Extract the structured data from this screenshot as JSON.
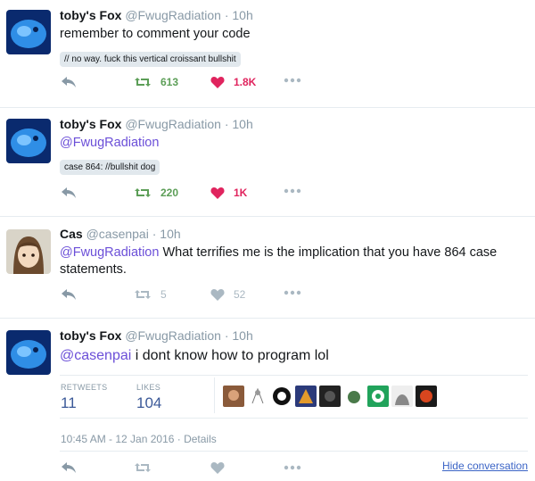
{
  "tweets": [
    {
      "name": "toby's Fox",
      "handle": "@FwugRadiation",
      "time": "· 10h",
      "text": "remember to comment your code",
      "code": "// no way. fuck this vertical croissant bullshit",
      "retweets": "613",
      "likes": "1.8K"
    },
    {
      "name": "toby's Fox",
      "handle": "@FwugRadiation",
      "time": "· 10h",
      "mention": "@FwugRadiation",
      "code": "case 864: //bullshit dog",
      "retweets": "220",
      "likes": "1K"
    },
    {
      "name": "Cas",
      "handle": "@casenpai",
      "time": "· 10h",
      "mention": "@FwugRadiation",
      "text": " What terrifies me is the implication that you have 864 case statements.",
      "retweets": "5",
      "likes": "52"
    },
    {
      "name": "toby's Fox",
      "handle": "@FwugRadiation",
      "time": "· 10h",
      "mention": "@casenpai",
      "text": " i dont know how to program lol",
      "retweets_label": "RETWEETS",
      "retweets": "11",
      "likes_label": "LIKES",
      "likes": "104",
      "timestamp": "10:45 AM - 12 Jan 2016 · Details",
      "hide": "Hide conversation"
    }
  ],
  "colors": {
    "accent_purple": "#6b4fd8",
    "retweet_green": "#5c9e57",
    "like_red": "#e0245e",
    "muted": "#aab8c2"
  }
}
